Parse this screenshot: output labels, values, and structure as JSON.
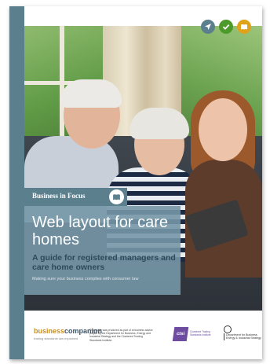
{
  "cover": {
    "series_label": "Business in Focus",
    "title": "Web layout for care homes",
    "subtitle": "A guide for registered managers and care home owners",
    "tagline": "Making sure your business complies with consumer law"
  },
  "top_icons": [
    {
      "name": "navigation-arrow-icon",
      "color": "#5c7f8e"
    },
    {
      "name": "checkmark-icon",
      "color": "#4c9a2a"
    },
    {
      "name": "open-book-icon",
      "color": "#e0a21b"
    }
  ],
  "footer": {
    "logo_business": "business",
    "logo_companion": "companion",
    "logo_tagline": "trading standards law explained",
    "description": "This guide was produced as part of a business advice project by the Department for Business, Energy and Industrial Strategy and the Chartered Trading Standards Institute.",
    "ctsi_mark": "ctsi",
    "ctsi_name": "Chartered Trading Standards Institute",
    "dept_name": "Department for Business, Energy & Industrial Strategy"
  },
  "colors": {
    "spine": "#5c7f8e",
    "title_box": "#7697a7",
    "subtitle": "#2e4a58",
    "ctsi_purple": "#6d4ca0"
  }
}
